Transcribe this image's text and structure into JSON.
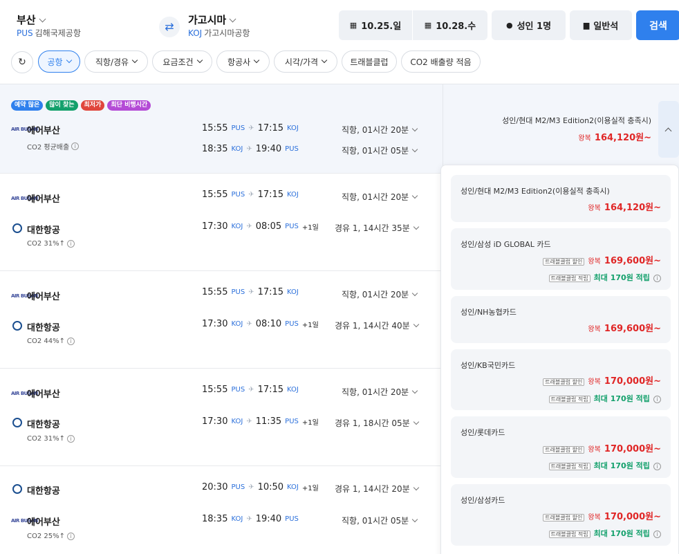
{
  "header": {
    "origin": {
      "city": "부산",
      "code": "PUS",
      "airport": "김해국제공항"
    },
    "destination": {
      "city": "가고시마",
      "code": "KOJ",
      "airport": "가고시마공항"
    },
    "swap_icon": "⇄",
    "date_out": "10.25.일",
    "date_back": "10.28.수",
    "passengers": "성인 1명",
    "cabin": "일반석",
    "search": "검색"
  },
  "filters": {
    "refresh_icon": "↻",
    "chips": [
      "공항",
      "직항/경유",
      "요금조건",
      "항공사",
      "시각/가격",
      "트래블클럽",
      "CO2 배출량 적음"
    ]
  },
  "first_result": {
    "badges": [
      {
        "text": "예약 많은",
        "color": "#2f80ed"
      },
      {
        "text": "많이 찾는",
        "color": "#13a06b"
      },
      {
        "text": "최저가",
        "color": "#e0463c"
      },
      {
        "text": "최단 비행시간",
        "color": "#b44bd6"
      }
    ],
    "airline": "에어부산",
    "co2": "CO2 평균배출",
    "out": {
      "dep": "15:55",
      "dep_ap": "PUS",
      "arr": "17:15",
      "arr_ap": "KOJ",
      "dur": "직항, 01시간 20분"
    },
    "back": {
      "dep": "18:35",
      "dep_ap": "KOJ",
      "arr": "19:40",
      "arr_ap": "PUS",
      "dur": "직항, 01시간 05분"
    },
    "fare_name": "성인/현대 M2/M3 Edition2(이용실적 충족시)",
    "round_trip": "왕복",
    "price": "164,120원~"
  },
  "results": [
    {
      "a1": "에어부산",
      "a2": "대한항공",
      "co2": "CO2 31%↑",
      "o": {
        "dep": "15:55",
        "dep_ap": "PUS",
        "arr": "17:15",
        "arr_ap": "KOJ",
        "dur": "직항, 01시간 20분"
      },
      "r": {
        "dep": "17:30",
        "dep_ap": "KOJ",
        "arr": "08:05",
        "arr_ap": "PUS",
        "plus": "+1일",
        "dur": "경유 1, 14시간 35분"
      }
    },
    {
      "a1": "에어부산",
      "a2": "대한항공",
      "co2": "CO2 44%↑",
      "o": {
        "dep": "15:55",
        "dep_ap": "PUS",
        "arr": "17:15",
        "arr_ap": "KOJ",
        "dur": "직항, 01시간 20분"
      },
      "r": {
        "dep": "17:30",
        "dep_ap": "KOJ",
        "arr": "08:10",
        "arr_ap": "PUS",
        "plus": "+1일",
        "dur": "경유 1, 14시간 40분"
      }
    },
    {
      "a1": "에어부산",
      "a2": "대한항공",
      "co2": "CO2 31%↑",
      "o": {
        "dep": "15:55",
        "dep_ap": "PUS",
        "arr": "17:15",
        "arr_ap": "KOJ",
        "dur": "직항, 01시간 20분"
      },
      "r": {
        "dep": "17:30",
        "dep_ap": "KOJ",
        "arr": "11:35",
        "arr_ap": "PUS",
        "plus": "+1일",
        "dur": "경유 1, 18시간 05분"
      }
    },
    {
      "a1": "대한항공",
      "a2": "에어부산",
      "co2": "CO2 25%↑",
      "o": {
        "dep": "20:30",
        "dep_ap": "PUS",
        "arr": "10:50",
        "arr_ap": "KOJ",
        "plus": "+1일",
        "dur": "경유 1, 14시간 20분"
      },
      "r": {
        "dep": "18:35",
        "dep_ap": "KOJ",
        "arr": "19:40",
        "arr_ap": "PUS",
        "dur": "직항, 01시간 05분"
      }
    }
  ],
  "fares": [
    {
      "name": "성인/현대 M2/M3 Edition2(이용실적 충족시)",
      "rt": "왕복",
      "price": "164,120원~"
    },
    {
      "name": "성인/삼성 iD GLOBAL 카드",
      "tag1": "트래블클럽 할인",
      "rt": "왕복",
      "price": "169,600원~",
      "tag2": "트래블클럽 적립",
      "reward": "최대 170원 적립"
    },
    {
      "name": "성인/NH농협카드",
      "rt": "왕복",
      "price": "169,600원~"
    },
    {
      "name": "성인/KB국민카드",
      "tag1": "트래블클럽 할인",
      "rt": "왕복",
      "price": "170,000원~",
      "tag2": "트래블클럽 적립",
      "reward": "최대 170원 적립"
    },
    {
      "name": "성인/롯데카드",
      "tag1": "트래블클럽 할인",
      "rt": "왕복",
      "price": "170,000원~",
      "tag2": "트래블클럽 적립",
      "reward": "최대 170원 적립"
    },
    {
      "name": "성인/삼성카드",
      "tag1": "트래블클럽 할인",
      "rt": "왕복",
      "price": "170,000원~",
      "tag2": "트래블클럽 적립",
      "reward": "최대 170원 적립"
    }
  ],
  "colors": {
    "accent": "#2f80ed",
    "price": "#e02626",
    "reward": "#13a06b",
    "airport_code": "#2a6fdb"
  }
}
